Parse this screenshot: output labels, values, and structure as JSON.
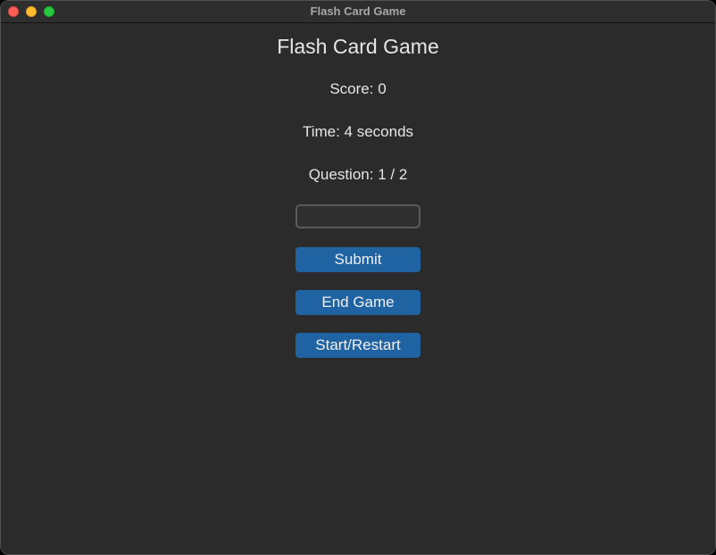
{
  "window": {
    "title": "Flash Card Game"
  },
  "game": {
    "heading": "Flash Card Game",
    "score_text": "Score: 0",
    "time_text": "Time: 4 seconds",
    "question_text": "Question: 1 / 2",
    "answer_value": "",
    "answer_placeholder": ""
  },
  "buttons": {
    "submit_label": "Submit",
    "end_label": "End Game",
    "restart_label": "Start/Restart"
  },
  "colors": {
    "background": "#2b2b2b",
    "button": "#1f63a3",
    "text": "#e6e6e6",
    "close": "#ff5f57",
    "minimize": "#febc2e",
    "zoom": "#28c840"
  }
}
